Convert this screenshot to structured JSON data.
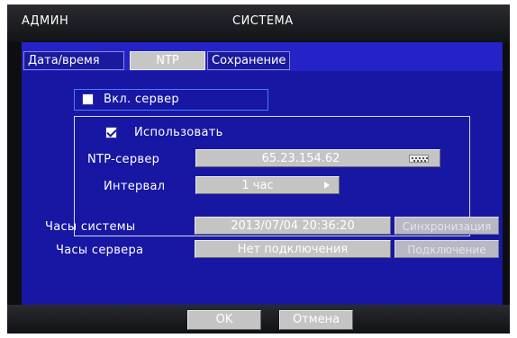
{
  "window": {
    "user": "АДМИН",
    "title": "СИСТЕМА"
  },
  "tabs": [
    {
      "label": "Дата/время",
      "active": false
    },
    {
      "label": "NTP",
      "active": true
    },
    {
      "label": "Сохранение",
      "active": false
    }
  ],
  "ntp": {
    "enable_server_label": "Вкл. сервер",
    "enable_server_checked": false,
    "use_label": "Использовать",
    "use_checked": true,
    "server_label": "NTP-сервер",
    "server_value": "65.23.154.62",
    "interval_label": "Интервал",
    "interval_value": "1 час"
  },
  "clocks": {
    "system_label": "Часы системы",
    "system_value": "2013/07/04  20:36:20",
    "sync_button": "Синхронизация",
    "server_label": "Часы сервера",
    "server_value": "Нет подключения",
    "connect_button": "Подключение"
  },
  "footer": {
    "ok": "OK",
    "cancel": "Отмена"
  },
  "colors": {
    "panel": "#1717a4",
    "tabbar": "#2323c8",
    "field": "#c4c4c4",
    "frame": "#0e0e10"
  },
  "icons": {
    "keyboard": "keyboard-icon",
    "interval_arrow": "triangle-right-icon",
    "checkbox": "checkbox-icon"
  }
}
